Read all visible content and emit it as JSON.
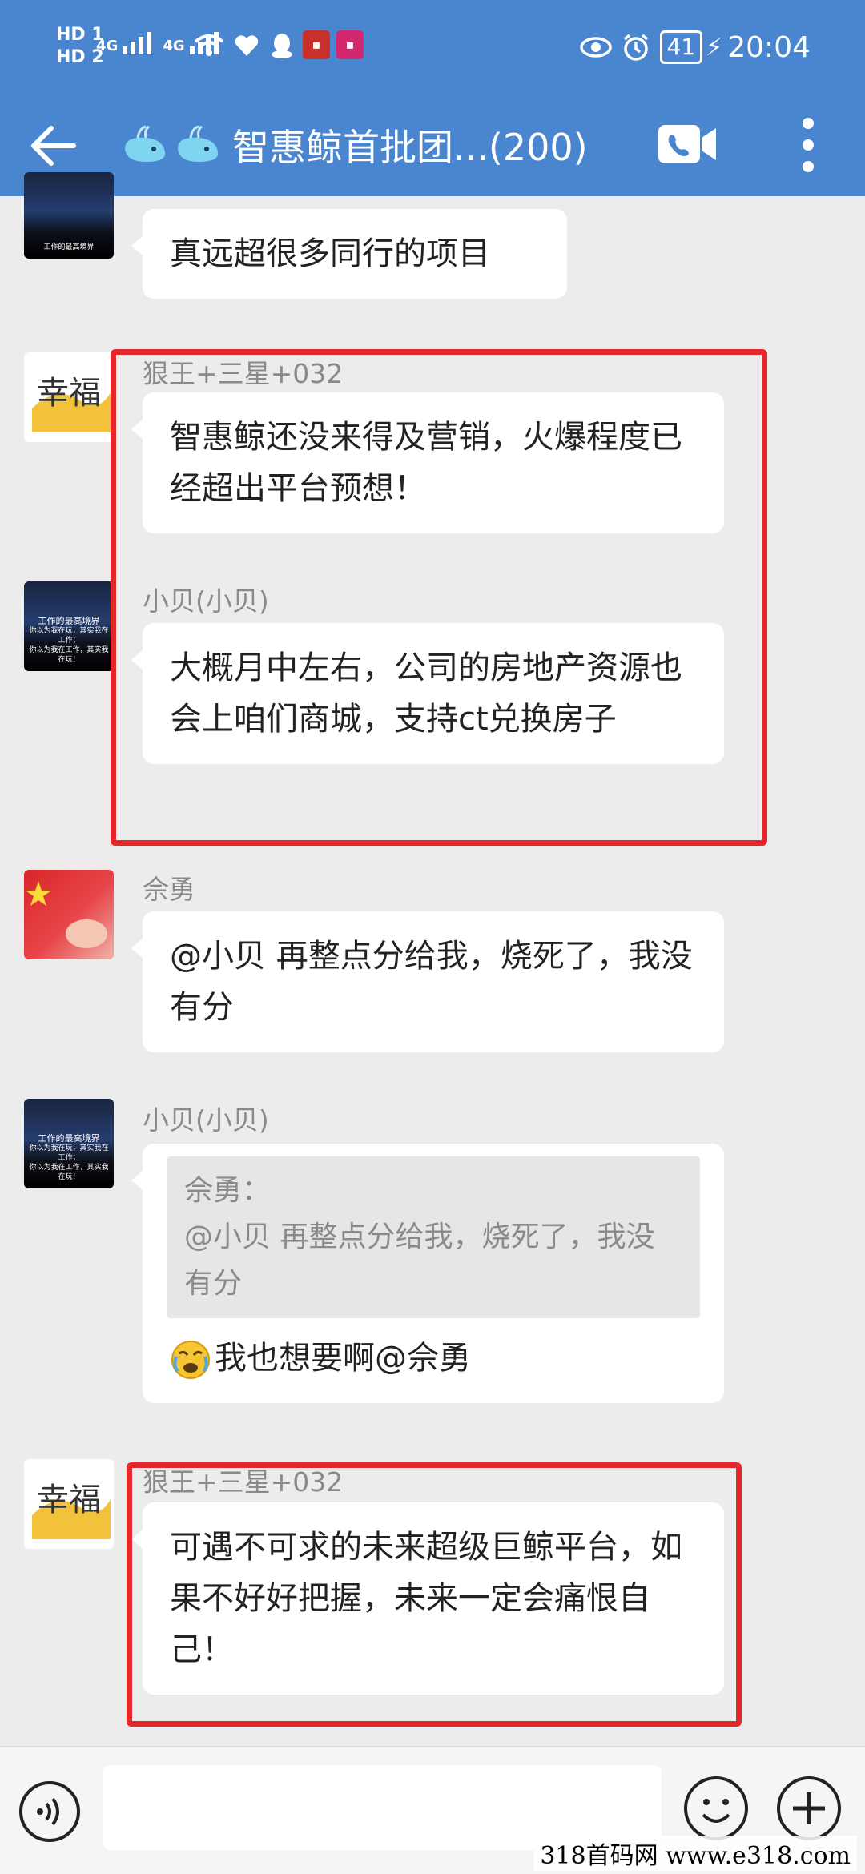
{
  "status_bar": {
    "hd_1": "HD 1",
    "hd_2": "HD 2",
    "net_1": "4G",
    "net_2": "4G",
    "battery": "41",
    "time": "20:04"
  },
  "header": {
    "title": "智惠鲸首批团...(200)",
    "accent_color": "#4a86cf"
  },
  "messages": [
    {
      "id": "m1",
      "sender": "",
      "text": "真远超很多同行的项目"
    },
    {
      "id": "m2",
      "sender": "狠王+三星+032",
      "text": "智惠鲸还没来得及营销，火爆程度已经超出平台预想！"
    },
    {
      "id": "m3",
      "sender": "小贝(小贝)",
      "text": "大概月中左右，公司的房地产资源也会上咱们商城，支持ct兑换房子"
    },
    {
      "id": "m4",
      "sender": "佘勇",
      "text": "@小贝 再整点分给我，烧死了，我没有分"
    },
    {
      "id": "m5",
      "sender": "小贝(小贝)",
      "quote_author": "佘勇：",
      "quote_text": "@小贝 再整点分给我，烧死了，我没有分",
      "text": "我也想要啊@佘勇"
    },
    {
      "id": "m6",
      "sender": "狠王+三星+032",
      "text": "可遇不可求的未来超级巨鲸平台，如果不好好把握，未来一定会痛恨自己！"
    }
  ],
  "avatars": {
    "city_line1": "工作的最高境界",
    "city_line2": "你以为我在玩，其实我在工作；",
    "city_line3": "你以为我在工作，其实我在玩！",
    "happy_text": "幸福"
  },
  "highlight_color": "#e5262b",
  "watermark": "318首码网  www.e318.com"
}
